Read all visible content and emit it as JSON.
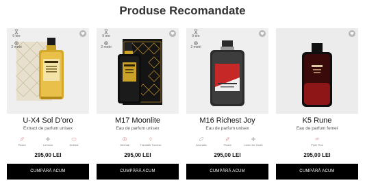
{
  "section_title": "Produse Recomandate",
  "buy_label": "CUMPĂRĂ ACUM",
  "products": [
    {
      "name": "U-X4 Sol D’oro",
      "subtitle": "Extract de parfum unisex",
      "time": "9 ore",
      "distance": "2 metri",
      "notes": [
        "Picant",
        "Lemnos",
        "Ambrat"
      ],
      "price": "295,00 LEI",
      "image": "gold-perfume-bottle-with-box"
    },
    {
      "name": "M17 Moonlite",
      "subtitle": "Eau de parfum unisex",
      "time": "9 ore",
      "distance": "2 metri",
      "notes": [
        "Oriental",
        "Trandafir Turcesc"
      ],
      "price": "295,00 LEI",
      "image": "black-perfume-bottle-with-box"
    },
    {
      "name": "M16 Richest Joy",
      "subtitle": "Eau de parfum unisex",
      "time": "9 ore",
      "distance": "2 metri",
      "notes": [
        "Aromatic",
        "Picant",
        "Lemn De Oudh"
      ],
      "price": "295,00 LEI",
      "image": "dark-perfume-bottle-red-label"
    },
    {
      "name": "K5 Rune",
      "subtitle": "Eau de parfum femei",
      "notes": [
        "Piper Roz"
      ],
      "price": "295,00 LEI",
      "image": "red-black-perfume-bottle"
    }
  ]
}
